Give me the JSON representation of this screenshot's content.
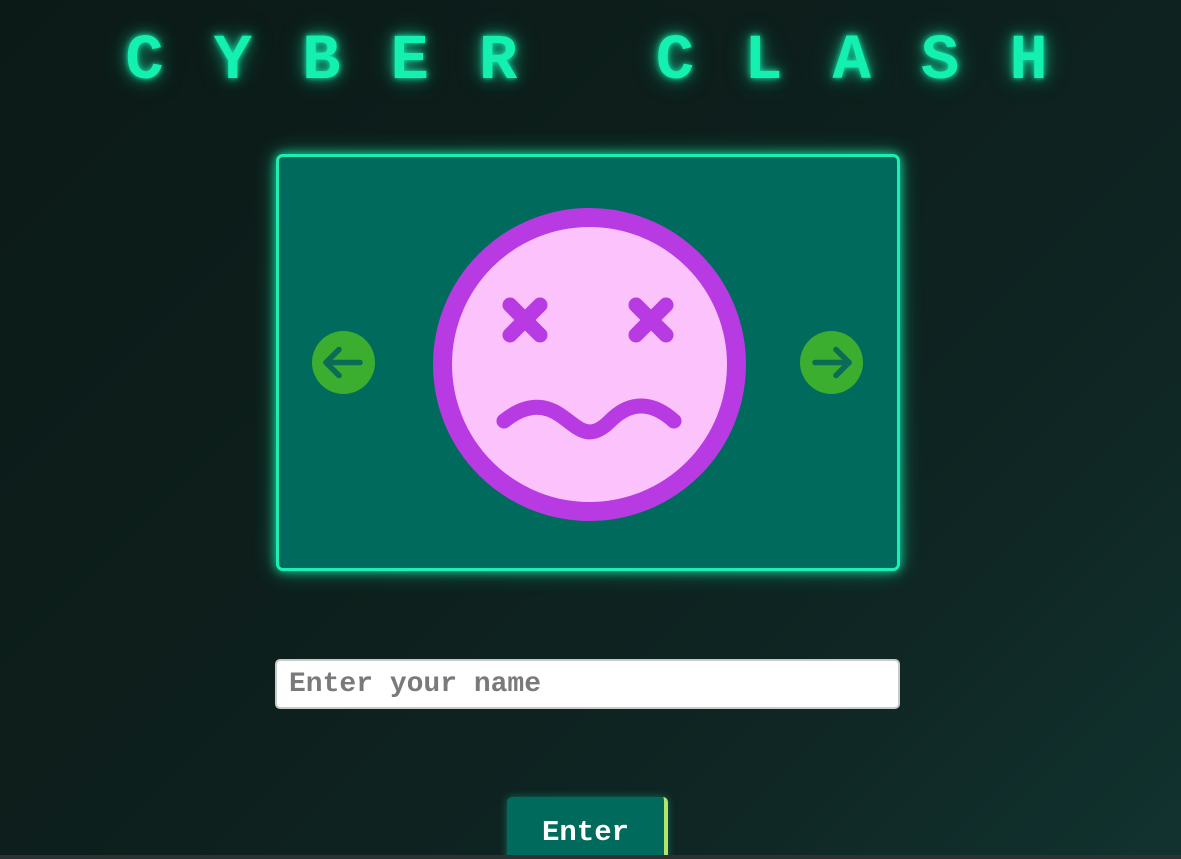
{
  "title": "CYBER CLASH",
  "avatar_selector": {
    "prev_icon": "arrow-left-icon",
    "next_icon": "arrow-right-icon",
    "avatar_icon": "dizzy-face-icon",
    "colors": {
      "panel": "#006b5c",
      "panel_border": "#19f0b2",
      "arrow_bg": "#3bad2f",
      "arrow_fg": "#0b6b55",
      "face_fill": "#fbc2fb",
      "face_stroke": "#b83ae3"
    }
  },
  "name_field": {
    "placeholder": "Enter your name",
    "value": ""
  },
  "enter_button": {
    "label": "Enter"
  },
  "theme": {
    "accent": "#14f0b0",
    "background": "#0d1f1c"
  }
}
